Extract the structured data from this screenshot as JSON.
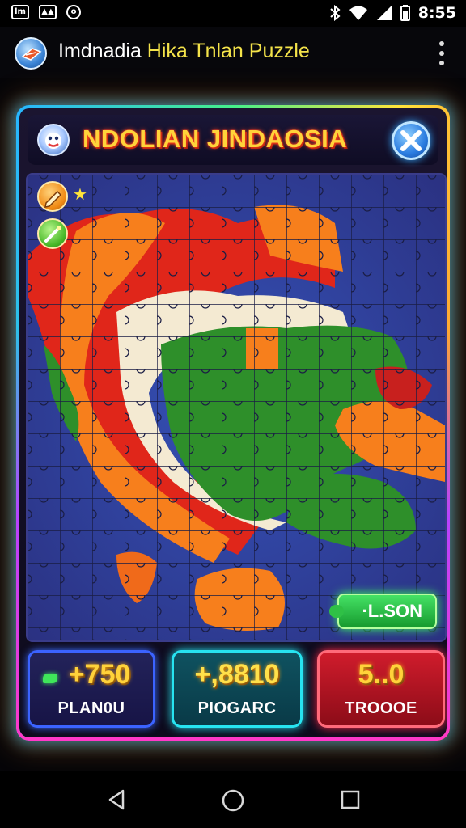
{
  "status_bar": {
    "left_icons": [
      {
        "icon": "notification-app-icon",
        "glyph": "lm"
      },
      {
        "icon": "image-icon",
        "glyph": "▲▲"
      },
      {
        "icon": "circle-notification-icon",
        "glyph": "o"
      }
    ],
    "right_icons": [
      "bluetooth-icon",
      "wifi-icon",
      "signal-icon",
      "battery-icon"
    ],
    "time": "8:55"
  },
  "app_bar": {
    "title_white": "Imdnadia ",
    "title_yellow": "Hika Tnlan",
    "title_rest": " Puzzle",
    "menu_icon": "more-vert-icon"
  },
  "game": {
    "header_title": "NDOLIAN JINDAOSIA",
    "close_icon": "close-icon",
    "tools": [
      "hint-pencil-icon",
      "hint-wand-icon"
    ],
    "lesson_button": "·L.SON",
    "stats": [
      {
        "value": "+750",
        "label": "PLAN0U"
      },
      {
        "value": "+,8810",
        "label": "PIOGARC"
      },
      {
        "value": "5..0",
        "label": "TROOOE"
      }
    ]
  },
  "colors": {
    "ocean": "#2e3f9c",
    "land_red": "#e0261a",
    "land_orange": "#f77f1c",
    "land_green": "#2e8f2a",
    "land_cream": "#f4ead2",
    "frame_cyan": "#27b6ff",
    "frame_magenta": "#ff38c8"
  },
  "nav_bar": {
    "back": "back-icon",
    "home": "home-icon",
    "recents": "recents-icon"
  }
}
